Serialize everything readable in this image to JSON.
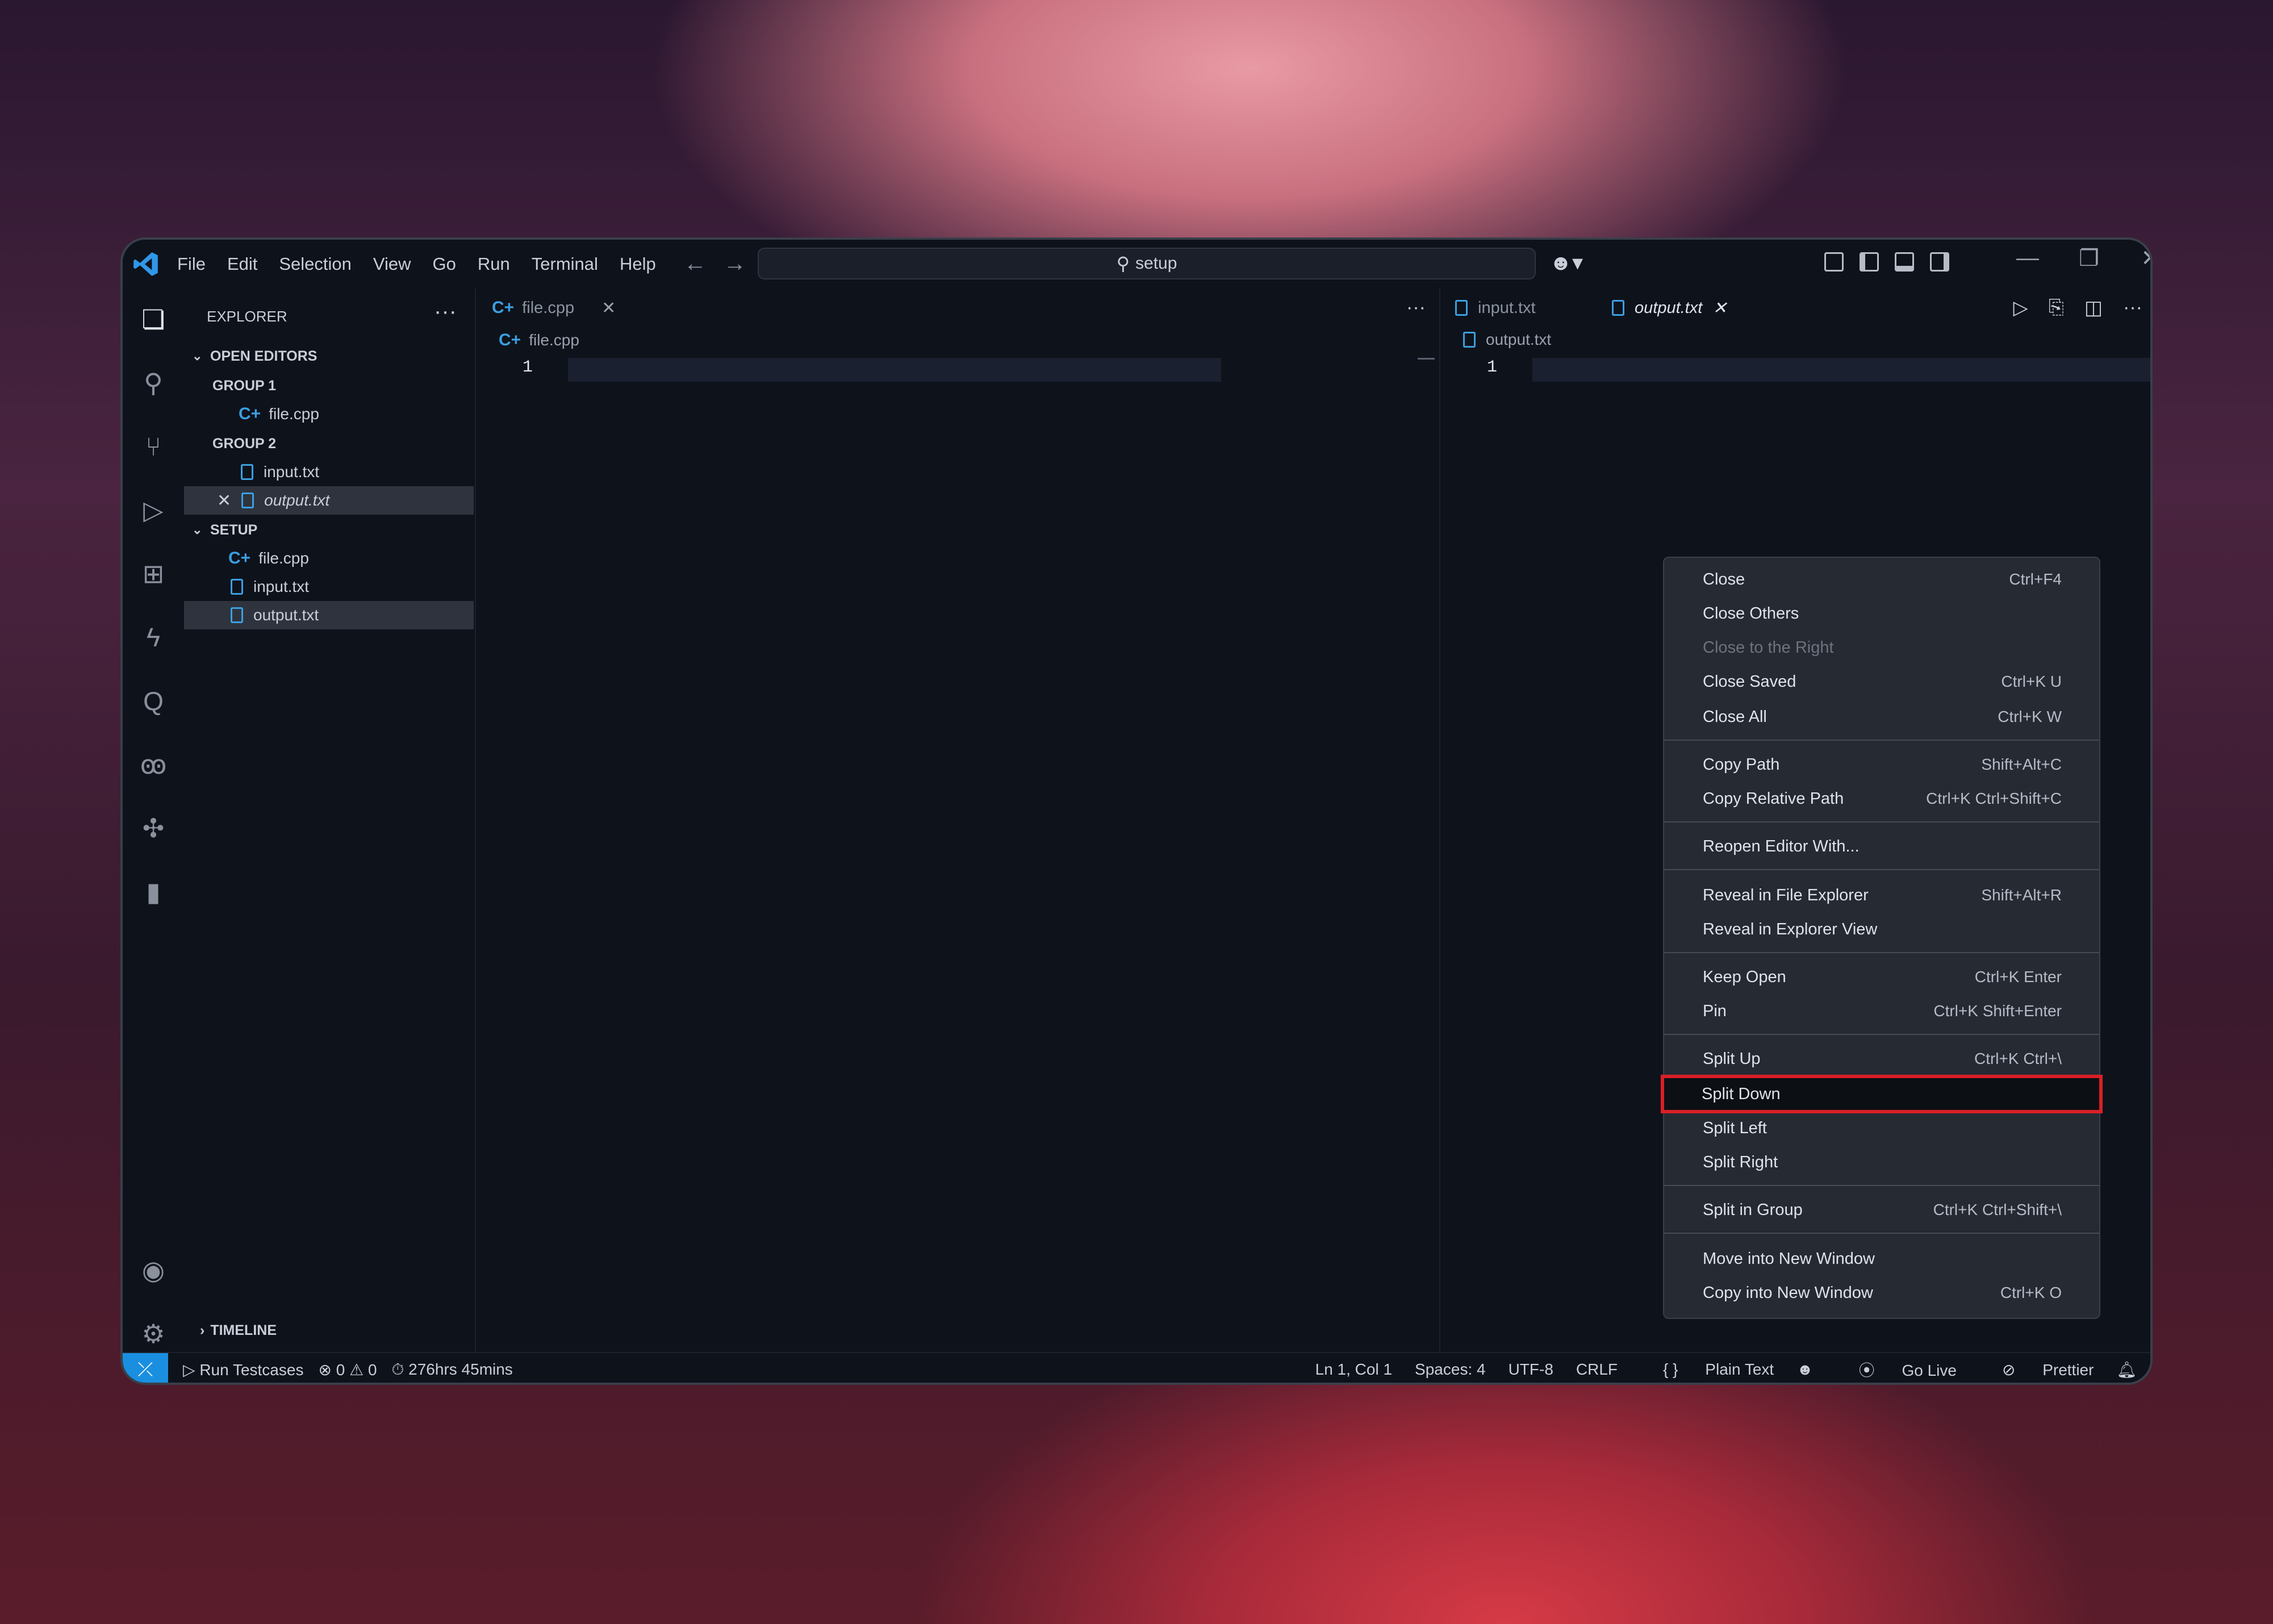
{
  "menu": [
    "File",
    "Edit",
    "Selection",
    "View",
    "Go",
    "Run",
    "Terminal",
    "Help"
  ],
  "search": {
    "label": "setup"
  },
  "sidebar": {
    "title": "EXPLORER",
    "open_editors": "OPEN EDITORS",
    "group1": "GROUP 1",
    "group1_file": "file.cpp",
    "group2": "GROUP 2",
    "group2_file1": "input.txt",
    "group2_file2": "output.txt",
    "folder": "SETUP",
    "folder_files": [
      "file.cpp",
      "input.txt",
      "output.txt"
    ],
    "timeline": "TIMELINE"
  },
  "editor1": {
    "tab": "file.cpp",
    "breadcrumb": "file.cpp",
    "line": "1"
  },
  "editor2": {
    "tabs": [
      "input.txt",
      "output.txt"
    ],
    "breadcrumb": "output.txt",
    "line": "1"
  },
  "context_menu": [
    {
      "label": "Close",
      "shortcut": "Ctrl+F4"
    },
    {
      "label": "Close Others",
      "shortcut": ""
    },
    {
      "label": "Close to the Right",
      "shortcut": "",
      "disabled": true
    },
    {
      "label": "Close Saved",
      "shortcut": "Ctrl+K U"
    },
    {
      "label": "Close All",
      "shortcut": "Ctrl+K W"
    },
    {
      "label": "Copy Path",
      "shortcut": "Shift+Alt+C"
    },
    {
      "label": "Copy Relative Path",
      "shortcut": "Ctrl+K Ctrl+Shift+C"
    },
    {
      "label": "Reopen Editor With...",
      "shortcut": ""
    },
    {
      "label": "Reveal in File Explorer",
      "shortcut": "Shift+Alt+R"
    },
    {
      "label": "Reveal in Explorer View",
      "shortcut": ""
    },
    {
      "label": "Keep Open",
      "shortcut": "Ctrl+K Enter"
    },
    {
      "label": "Pin",
      "shortcut": "Ctrl+K Shift+Enter"
    },
    {
      "label": "Split Up",
      "shortcut": "Ctrl+K Ctrl+\\"
    },
    {
      "label": "Split Down",
      "shortcut": "",
      "highlighted": true
    },
    {
      "label": "Split Left",
      "shortcut": ""
    },
    {
      "label": "Split Right",
      "shortcut": ""
    },
    {
      "label": "Split in Group",
      "shortcut": "Ctrl+K Ctrl+Shift+\\"
    },
    {
      "label": "Move into New Window",
      "shortcut": ""
    },
    {
      "label": "Copy into New Window",
      "shortcut": "Ctrl+K O"
    }
  ],
  "status": {
    "run_testcases": "Run Testcases",
    "errors": "0",
    "warnings": "0",
    "time": "276hrs 45mins",
    "position": "Ln 1, Col 1",
    "spaces": "Spaces: 4",
    "encoding": "UTF-8",
    "eol": "CRLF",
    "language": "Plain Text",
    "golive": "Go Live",
    "prettier": "Prettier"
  },
  "colors": {
    "accent": "#1a8fe0",
    "highlight_border": "#d91f26",
    "file_icon": "#3b9fe0"
  }
}
